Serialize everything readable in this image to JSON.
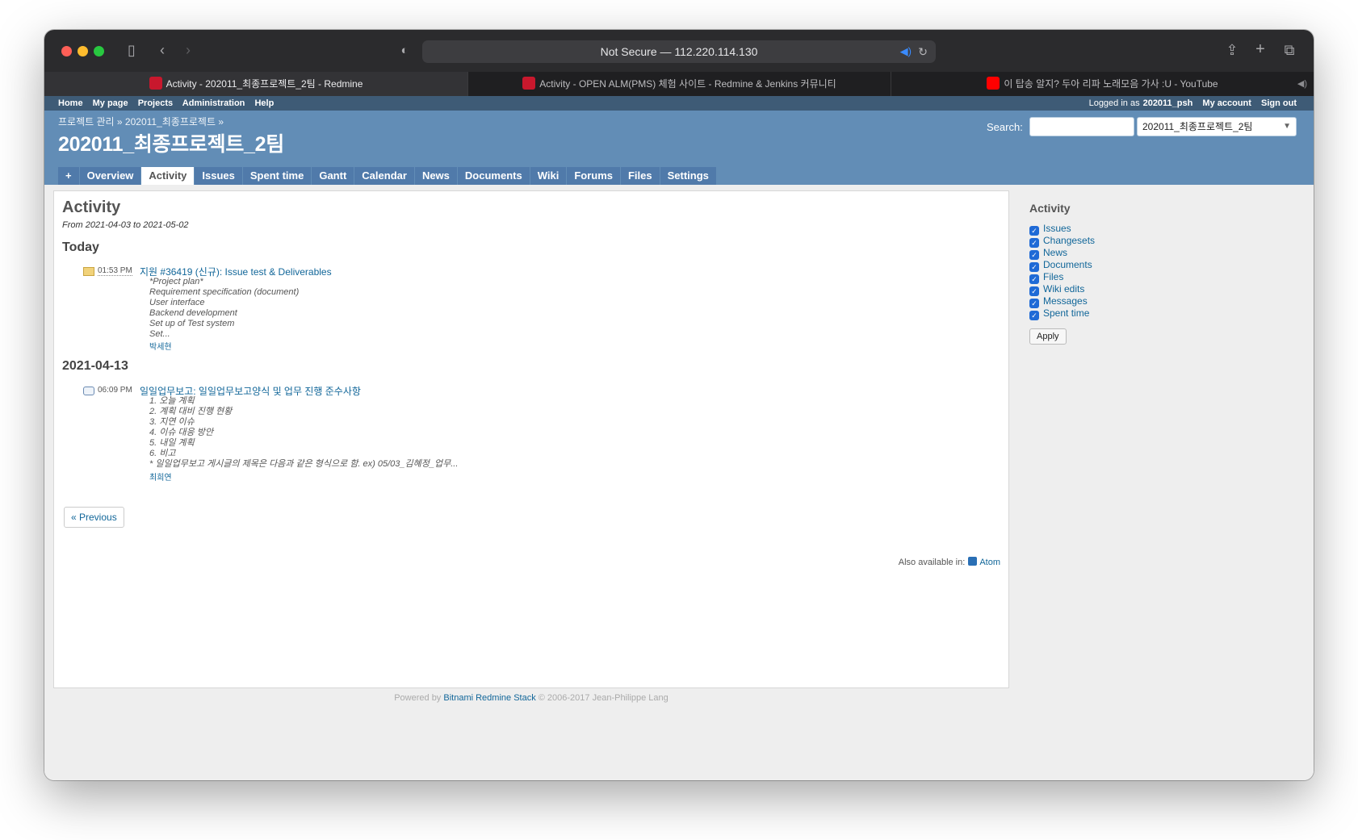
{
  "browser": {
    "address": "Not Secure — 112.220.114.130",
    "tabs": [
      {
        "title": "Activity - 202011_최종프로젝트_2팀 - Redmine"
      },
      {
        "title": "Activity - OPEN ALM(PMS) 체험 사이트 - Redmine & Jenkins 커뮤니티"
      },
      {
        "title": "이 탑송 알지? 두아 리파 노래모음 가사 :U - YouTube"
      }
    ]
  },
  "top_menu": {
    "home": "Home",
    "my_page": "My page",
    "projects": "Projects",
    "administration": "Administration",
    "help": "Help",
    "logged_in_as": "Logged in as",
    "user": "202011_psh",
    "my_account": "My account",
    "sign_out": "Sign out"
  },
  "header": {
    "breadcrumb": "프로젝트 관리 » 202011_최종프로젝트 »",
    "title": "202011_최종프로젝트_2팀",
    "search_label": "Search:",
    "search_value": "",
    "project_jump": "202011_최종프로젝트_2팀"
  },
  "main_menu": {
    "new": "+",
    "items": [
      "Overview",
      "Activity",
      "Issues",
      "Spent time",
      "Gantt",
      "Calendar",
      "News",
      "Documents",
      "Wiki",
      "Forums",
      "Files",
      "Settings"
    ]
  },
  "content": {
    "title": "Activity",
    "range": "From 2021-04-03 to 2021-05-02",
    "days": [
      {
        "heading": "Today",
        "event": {
          "time": "01:53 PM",
          "title": "지원 #36419 (신규): Issue test & Deliverables",
          "lines": [
            "*Project plan*",
            "Requirement specification (document)",
            "User interface",
            "Backend development",
            "Set up of Test system",
            "Set..."
          ],
          "author": "박세현"
        }
      },
      {
        "heading": "2021-04-13",
        "event": {
          "time": "06:09 PM",
          "title": "일일업무보고: 일일업무보고양식 및 업무 진행 준수사항",
          "lines": [
            "1. 오늘 계획",
            "2. 계획 대비 진행 현황",
            "3. 지연 이슈",
            "4. 이슈 대응 방안",
            "5. 내일 계획",
            "6. 비고",
            "* 일일업무보고 게시글의 제목은 다음과 같은 형식으로 함. ex) 05/03_김혜정_업무..."
          ],
          "author": "최희연"
        }
      }
    ],
    "previous": "« Previous",
    "also_available": "Also available in:",
    "atom": "Atom"
  },
  "sidebar": {
    "title": "Activity",
    "filters": [
      "Issues",
      "Changesets",
      "News",
      "Documents",
      "Files",
      "Wiki edits",
      "Messages",
      "Spent time"
    ],
    "apply": "Apply"
  },
  "footer": {
    "powered_by": "Powered by",
    "link": "Bitnami Redmine Stack",
    "copyright": "© 2006-2017 Jean-Philippe Lang"
  }
}
